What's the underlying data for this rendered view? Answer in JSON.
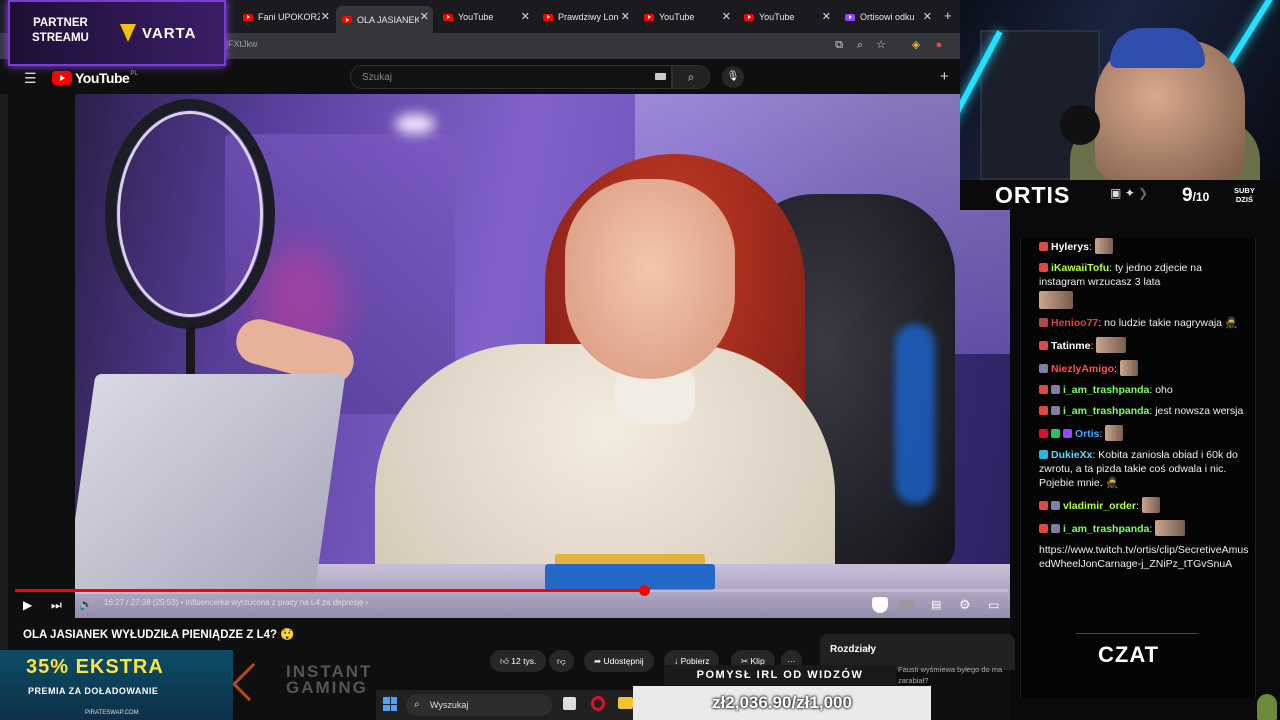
{
  "browser": {
    "tabs": [
      {
        "label": "Fani UPOKORZ",
        "icon": "youtube-icon",
        "active": false
      },
      {
        "label": "OLA JASIANEK",
        "icon": "youtube-icon",
        "active": true
      },
      {
        "label": "YouTube",
        "icon": "youtube-icon",
        "active": false
      },
      {
        "label": "Prawdziwy Lon",
        "icon": "youtube-icon",
        "active": false
      },
      {
        "label": "YouTube",
        "icon": "youtube-icon",
        "active": false
      },
      {
        "label": "YouTube",
        "icon": "youtube-icon",
        "active": false
      },
      {
        "label": "Ortisowi odku",
        "icon": "twitch-icon",
        "active": false
      }
    ],
    "url_fragment": "jFXtJkw",
    "tab_close_glyph": "✕",
    "new_tab_glyph": "+"
  },
  "youtube": {
    "logo_text": "YouTube",
    "logo_region": "PL",
    "search_placeholder": "Szukaj",
    "video": {
      "title": "OLA JASIANEK WYŁUDZIŁA PIENIĄDZE Z L4? 😲",
      "time": "16:27 / 27:38 (25:53)",
      "chapter": "• Influencerka wyrzucona z pracy na L4 za depresję",
      "chapter_arrow": "›",
      "progress_fraction": 0.633,
      "buffered_fraction": 0.68
    },
    "actions": {
      "likes": "12 tys.",
      "share": "Udostępnij",
      "download": "Pobierz",
      "clip": "Klip",
      "more": "···"
    },
    "chapters_panel_title": "Rozdziały",
    "suggestion_text": "Fausti wyśmiewa byłego do ma zarabiał?"
  },
  "overlays": {
    "partner_line1": "PARTNER",
    "partner_line2": "STREAMU",
    "sponsor": "VARTA",
    "promo_big": "35% EKSTRA",
    "promo_mid": "PREMIA ZA DOŁADOWANIE",
    "promo_site": "PIRATESWAP.COM",
    "instant_line1": "INSTANT",
    "instant_line2": "GAMING",
    "pomysl": "POMYSŁ IRL OD WIDZÓW",
    "donation_goal": "zł2,036.90/zł1,000"
  },
  "taskbar": {
    "search_label": "Wyszukaj"
  },
  "stream": {
    "channel_name": "ORTIS",
    "subs_today": "9",
    "subs_goal": "/10",
    "subs_label_line1": "SUBY",
    "subs_label_line2": "DZIŚ",
    "chat_label": "CZAT"
  },
  "chat": {
    "messages": [
      {
        "user": "Hylerys",
        "color": "#ffffff",
        "text": "",
        "emote": "sm",
        "badges": [
          "#e04848"
        ]
      },
      {
        "user": "iKawaiiTofu",
        "color": "#b6ff3f",
        "text": "ty jedno zdjecie na instagram wrzucasz 3 lata",
        "emote": "big",
        "badges": [
          "#e04848"
        ]
      },
      {
        "user": "Henioo77",
        "color": "#e0443b",
        "text": "no ludzie takie nagrywaja 🥷",
        "emote": "",
        "badges": [
          "#b04848"
        ]
      },
      {
        "user": "Tatinme",
        "color": "#ffffff",
        "text": "",
        "emote": "lg",
        "badges": [
          "#e04848"
        ]
      },
      {
        "user": "NiezlyAmigo",
        "color": "#ff4f4f",
        "text": "",
        "emote": "sm",
        "badges": [
          "#8080a0"
        ]
      },
      {
        "user": "i_am_trashpanda",
        "color": "#7cff5a",
        "text": "oho",
        "emote": "",
        "badges": [
          "#e04848",
          "#8080a0"
        ]
      },
      {
        "user": "i_am_trashpanda",
        "color": "#7cff5a",
        "text": "jest nowsza wersja",
        "emote": "",
        "badges": [
          "#e04848",
          "#8080a0"
        ]
      },
      {
        "user": "Ortis",
        "color": "#41a6ff",
        "text": "",
        "emote": "sm",
        "badges": [
          "#e0102a",
          "#26c45b",
          "#9146ff"
        ]
      },
      {
        "user": "DukieXx",
        "color": "#5fd6ff",
        "text": "Kobita zaniosła obiad i 60k do zwrotu, a ta pizda takie coś odwala i nic. Pojebie mnie. 🥷",
        "emote": "",
        "badges": [
          "#29b8e0"
        ]
      },
      {
        "user": "vladimir_order",
        "color": "#b6ff3f",
        "text": "",
        "emote": "sm",
        "badges": [
          "#e04848",
          "#8080a0"
        ]
      },
      {
        "user": "i_am_trashpanda",
        "color": "#7cff5a",
        "text": "",
        "emote": "lg",
        "badges": [
          "#e04848",
          "#8080a0"
        ]
      },
      {
        "user": "",
        "color": "#ffffff",
        "text": "https://www.twitch.tv/ortis/clip/SecretiveAmusedWheelJonCarnage-j_ZNiPz_tTGvSnuA",
        "emote": "",
        "badges": []
      }
    ]
  },
  "colors": {
    "youtube_red": "#ff0000",
    "twitch_purple": "#9146ff",
    "neon_cyan": "#22e0ff"
  }
}
